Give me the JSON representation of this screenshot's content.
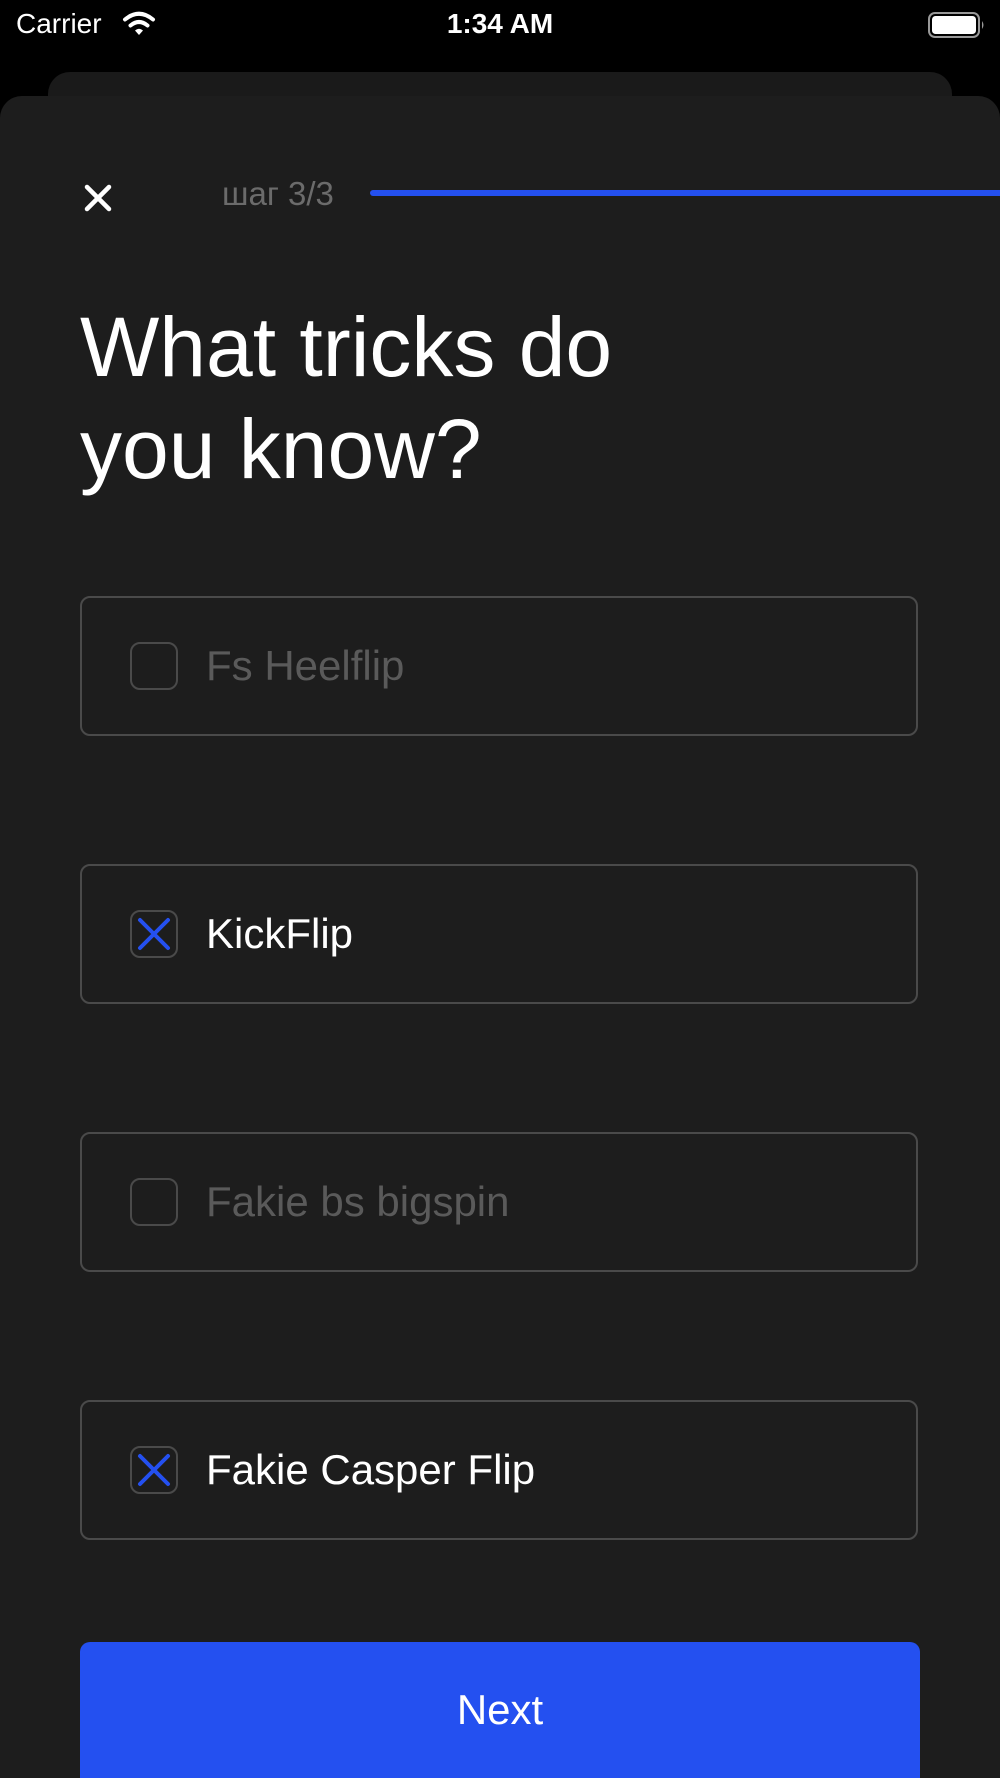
{
  "status_bar": {
    "carrier": "Carrier",
    "time": "1:34 AM",
    "wifi_icon": "wifi-icon",
    "battery_icon": "battery-icon"
  },
  "header": {
    "close_icon": "close-icon",
    "step_label": "шаг 3/3",
    "progress": 1.0
  },
  "title": "What tricks do\nyou know?",
  "options": [
    {
      "label": "Fs Heelflip",
      "checked": false
    },
    {
      "label": "KickFlip",
      "checked": true
    },
    {
      "label": "Fakie bs bigspin",
      "checked": false
    },
    {
      "label": "Fakie Casper Flip",
      "checked": true
    }
  ],
  "next_button": {
    "label": "Next"
  },
  "colors": {
    "accent": "#2450f0",
    "background": "#1d1d1d",
    "border": "#4a4a4a",
    "muted_text": "#5a5a5a",
    "text": "#ffffff"
  }
}
